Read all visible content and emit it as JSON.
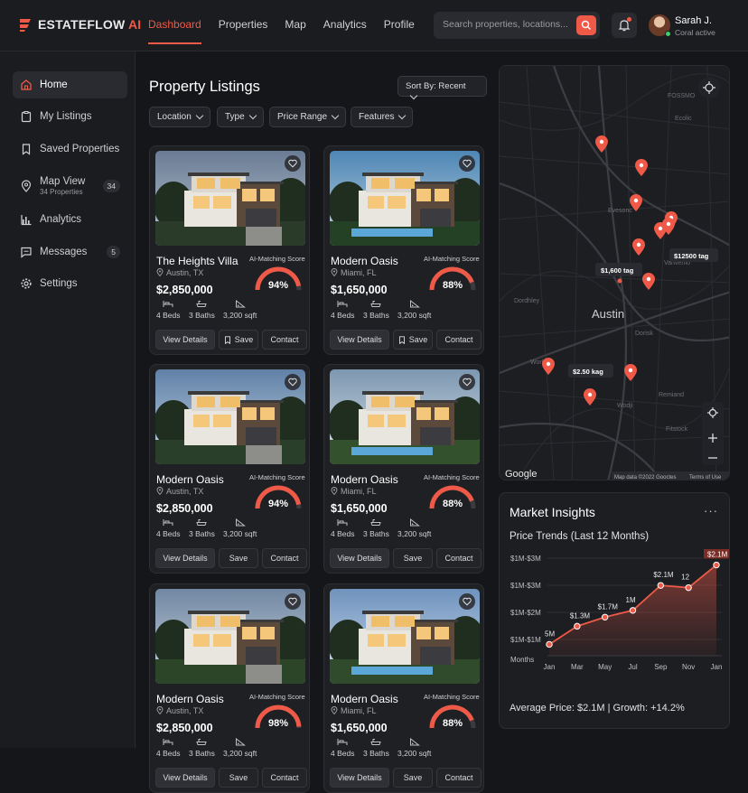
{
  "brand": {
    "name": "ESTATEFLOW",
    "ai": "AI"
  },
  "nav": [
    "Dashboard",
    "Properties",
    "Map",
    "Analytics",
    "Profile"
  ],
  "search": {
    "placeholder": "Search properties, locations..."
  },
  "user": {
    "name": "Sarah J.",
    "status": "Coral active"
  },
  "sidebar": {
    "items": [
      {
        "label": "Home",
        "icon": "home-icon"
      },
      {
        "label": "My Listings",
        "icon": "clipboard-icon"
      },
      {
        "label": "Saved Properties",
        "icon": "bookmark-icon"
      },
      {
        "label": "Map View",
        "sub": "34 Properties",
        "badge": "34",
        "icon": "pin-icon"
      },
      {
        "label": "Analytics",
        "icon": "bar-chart-icon"
      },
      {
        "label": "Messages",
        "badge": "5",
        "icon": "message-icon"
      },
      {
        "label": "Settings",
        "icon": "gear-icon"
      }
    ]
  },
  "listings": {
    "title": "Property Listings",
    "sort": "Sort By: Recent",
    "filters": [
      "Location",
      "Type",
      "Price Range",
      "Features"
    ],
    "score_label": "AI-Matching Score",
    "actions": {
      "view": "View Details",
      "save": "Save",
      "contact": "Contact"
    },
    "cards": [
      {
        "name": "The Heights Villa",
        "loc": "Austin, TX",
        "price": "$2,850,000",
        "score": "94%",
        "score_val": 94,
        "beds": "4 Beds",
        "baths": "3 Baths",
        "sqft": "3,200 sqft"
      },
      {
        "name": "Modern Oasis",
        "loc": "Miami, FL",
        "price": "$1,650,000",
        "score": "88%",
        "score_val": 88,
        "beds": "4 Beds",
        "baths": "3 Baths",
        "sqft": "3,200 sqft"
      },
      {
        "name": "Modern Oasis",
        "loc": "Austin, TX",
        "price": "$2,850,000",
        "score": "94%",
        "score_val": 94,
        "beds": "4 Beds",
        "baths": "3 Baths",
        "sqft": "3,200 sqft"
      },
      {
        "name": "Modern Oasis",
        "loc": "Miami, FL",
        "price": "$1,650,000",
        "score": "88%",
        "score_val": 88,
        "beds": "4 Beds",
        "baths": "3 Baths",
        "sqft": "3,200 sqft"
      },
      {
        "name": "Modern Oasis",
        "loc": "Austin, TX",
        "price": "$2,850,000",
        "score": "98%",
        "score_val": 98,
        "beds": "4 Beds",
        "baths": "3 Baths",
        "sqft": "3,200 sqft"
      },
      {
        "name": "Modern Oasis",
        "loc": "Miami, FL",
        "price": "$1,650,000",
        "score": "88%",
        "score_val": 88,
        "beds": "4 Beds",
        "baths": "3 Baths",
        "sqft": "3,200 sqft"
      }
    ]
  },
  "map": {
    "city": "Austin",
    "labels": [
      "FOSSMO",
      "Ecolic",
      "Evesonc",
      "Dordhley",
      "Vanvemo",
      "Worl",
      "Wodji",
      "Fitstock",
      "Remiand",
      "Dorisk"
    ],
    "tags": [
      "$1,600 tag",
      "$12500 tag",
      "$2.50 kag"
    ],
    "google": "Google",
    "attribution": "Map data ©2022 Gooctes",
    "terms": "Terms of Use"
  },
  "insights": {
    "title": "Market Insights",
    "more": "···",
    "subtitle": "Price Trends (Last 12 Months)",
    "footer": "Average Price: $2.1M  |  Growth: +14.2%"
  },
  "chart_data": {
    "type": "area",
    "title": "Price Trends (Last 12 Months)",
    "categories": [
      "Jan",
      "Mar",
      "May",
      "Jul",
      "Sep",
      "Nov",
      "Jan"
    ],
    "y_tick_labels": [
      "$1M-$3M",
      "$1M-$3M",
      "$1M-$2M",
      "$1M-$1M",
      "Months"
    ],
    "points": [
      {
        "x": "Jan",
        "y": 0.5,
        "label": "5M"
      },
      {
        "x": "Mar",
        "y": 1.3,
        "label": "$1.3M"
      },
      {
        "x": "May",
        "y": 1.7,
        "label": "$1.7M"
      },
      {
        "x": "Jul",
        "y": 2.0,
        "label": "1M"
      },
      {
        "x": "Sep",
        "y": 3.1,
        "label": "$2.1M"
      },
      {
        "x": "Nov",
        "y": 3.0,
        "label": "12"
      },
      {
        "x": "Jan",
        "y": 4.0,
        "label": "$2.1M"
      }
    ],
    "ylim": [
      0,
      4.3
    ],
    "colors": {
      "line": "#ef5a48",
      "fill": "#ef5a48"
    }
  }
}
